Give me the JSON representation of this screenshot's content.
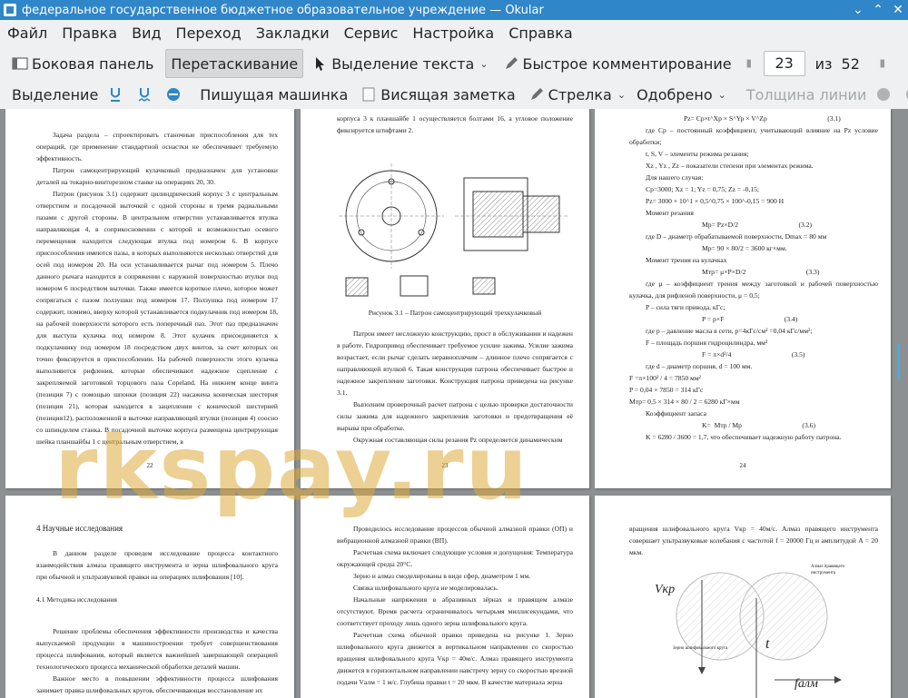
{
  "window": {
    "title": "федеральное государственное бюджетное образовательное учреждение  — Okular"
  },
  "menu": [
    "Файл",
    "Правка",
    "Вид",
    "Переход",
    "Закладки",
    "Сервис",
    "Настройка",
    "Справка"
  ],
  "toolbar1": {
    "sidebar": "Боковая панель",
    "drag": "Перетаскивание",
    "text_select": "Выделение текста",
    "quick_comment": "Быстрое комментирование",
    "page_current": "23",
    "page_of": "из",
    "page_total": "52"
  },
  "toolbar2": {
    "select": "Выделение",
    "typewriter": "Пишущая машинка",
    "note": "Висящая заметка",
    "arrow": "Стрелка",
    "stamp": "Одобрено",
    "line_width": "Толщина линии"
  },
  "watermark": "rkspay.ru",
  "pages": {
    "p22": {
      "number": "22",
      "paragraphs": [
        "Задача раздела – спроектировать станочные приспособления для тех операций, где применение стандартной оснастки не обеспечивает требуемую эффективность.",
        "Патрон самоцентрирующий кулачковый предназначен для установки деталей на токарно-винторезном станке на операциях 20, 30.",
        "Патрон (рисунок 3.1) содержит цилиндрический корпус 3 с центральным отверстием и посадочной выточкой с одной стороны и тремя радиальными пазами с другой стороны. В центральном отверстии устанавливается втулка направляющая 4, в соприкосновении с которой и возможностью осевого перемещения находится следующая втулка под номером 6. В корпусе приспособления имеются пазы, в которых выполняются несколько отверстий для осей под номером 20. На оси устанавливается рычаг под номером 5. Плечо данного рычага находится в сопряжении с наружной поверхностью втулки под номером 6 посредством выточки. Также имеется короткое плечо, которое может сопрягаться с пазом ползушки под номером 17. Ползушка под номером 17 содержит, помимо, вверху которой устанавливается подкулачник под номером 18, на рабочей поверхности которого есть поперечный паз. Этот паз предназначен для выступа кулачка под номером 8. Этот кулачек присоединяется к подкулачнику под номером 18 посредством двух винтов, за счет которых он точно фиксируется в приспособлении. На рабочей поверхности этого кулачка выполняются рифления, которые обеспечивают надежное сцепление с закрепляемой заготовкой торцового паза Copeland. На нижнем конце винта (позиция 7) с помощью шпонки (позиция 22) насажена коническая шестерня (позиция 21), которая находится в зацеплении с конической шестерней (позиция12), расположенной в выточке направляющей втулки (позиция 4) соосно со шпинделем станка. В посадочной выточке корпуса размещена центрирующая шейка планшайбы 1 с центральным отверстием, в"
      ]
    },
    "p23": {
      "number": "23",
      "intro": "корпуса 3 к планшайбе 1 осуществляется болтами 16, а угловое положение фиксируется штифтами 2.",
      "caption": "Рисунок 3.1 – Патрон самоцентрирующий трехкулачковый",
      "paragraphs": [
        "Патрон имеет несложную конструкцию, прост в обслуживании и надежен в работе. Гидропривод обеспечивает требуемое усилие зажима. Усилие зажима возрастает, если рычаг сделать неравноплечим – длинное плечо сопрягается с направляющей втулкой 6. Такая конструкция патрона обеспечивает быстрое и надежное закрепление заготовки. Конструкция патрона приведена на рисунке 3.1.",
        "Выполним проверочный расчет патрона с целью проверки достаточности силы зажима для надежного закрепления заготовки и предотвращения её вырыва при обработке.",
        "Окружная составляющая силы резания Pz определяется динамическим"
      ]
    },
    "p24": {
      "number": "24",
      "lines": [
        "Pz= Cp×t^Xp × S^Yp × V^Zp                                   (3.1)",
        "где Cp – постоянный коэффициент, учитывающий влияние на Pz условие обработки;",
        "t, S, V – элементы режима резания;",
        "Xz , Yz , Zz – показатели степени при элементах режима.",
        "Для нашего случая:",
        "Cp=3000;    Xz = 1;    Yz = 0,75;    Zz = -0,15;",
        "Pz= 3000 × 10^1 × 0,5^0,75 × 100^-0,15 = 900 Н",
        "Момент резания",
        "Mp= Pz×D/2                                   (3.2)",
        "где D – диаметр обрабатываемой поверхности,  Dmax = 80 мм",
        "Mp= 90 × 80/2 = 3600 кг×мм.",
        "Момент трения на кулачках",
        "Mтр= μ×P×D/2                                   (3.3)",
        "где μ – коэффициент трения между заготовкой и рабочей поверхностью кулачка, для рифленой поверхности,  μ = 0,5;",
        "P – сила тяги привода, кГс;",
        "P = p×F                                   (3.4)",
        "где p – давление масла в сети, p=4кГс/см² =0,04 кГс/мм²;",
        "F – площадь поршня гидроцилиндра, мм²",
        "F = π×d²/4                                   (3.5)",
        "где d – диаметр поршня, d = 100 мм.",
        "F =π×100² / 4 = 7850 мм²",
        "P = 0,04 × 7850 = 314 кГс",
        "Mтр= 0,5 × 314 × 80 / 2 = 6280 кГ×мм",
        "Коэффициент запаса",
        "K=  Mтр / Mp                                   (3.6)",
        "K = 6280 / 3600 = 1,7, что обеспечивает надежную работу патрона."
      ]
    },
    "p25": {
      "heading": "4 Научные исследования",
      "intro": "В данном разделе проведем исследование процесса контактного взаимодействия алмаза правящего инструмента и зерна шлифовального круга при обычной и ультразвуковой правки на операциях шлифования [10].",
      "subheading": "4.1 Методика исследования",
      "paragraphs": [
        "Решение проблемы обеспечения эффективности производства и качества выпускаемой продукции в машиностроении требует совершенствования процесса шлифования, который является важнейшей завершающей операцией технологического процесса механической обработки деталей машин.",
        "Важное место в повышении эффективности процесса шлифования занимает правка шлифовальных кругов, обеспечивающая восстановление их"
      ]
    },
    "p26": {
      "paragraphs": [
        "Проводилось исследование процессов обычной алмазной правки (ОП) и вибрационной алмазной правки (ВП).",
        "Расчетная схема включает следующие условия и допущения: Температура окружающей среды 20°С.",
        "Зерно и алмаз смоделированы в виде сфер, диаметром 1 мм.",
        "Связка шлифовального круга не моделировалась.",
        "Начальные напряжения в абразивных зёрнах и правящем алмазе отсутствуют. Время расчета ограничивалось четырьмя миллисекундами, что соответствует проходу лишь одного зерна шлифовального круга.",
        "Расчетная схема обычной правки приведена на рисунке 1. Зерно шлифовального круга движется в вертикальном направлении со скоростью вращения шлифовального круга Vкр = 40м/с. Алмаз правящего инструмента движется в горизонтальном направлении навстречу зерну со скоростью врезной подачи Vалм = 1 м/с. Глубина правки t = 20 мкм. В качестве материала зерна"
      ]
    },
    "p27": {
      "intro": "вращения шлифовального круга Vкр = 40м/с. Алмаз правящего инструмента совершает ультразвуковые колебания с частотой f = 20000 Гц и амплитудой A = 20 мкм.",
      "labels": {
        "vkr": "Vкр",
        "diamond": "Алмаз правящего инструмента",
        "grain": "Зерно шлифовального круга",
        "t": "t",
        "falm": "fалм"
      }
    }
  }
}
